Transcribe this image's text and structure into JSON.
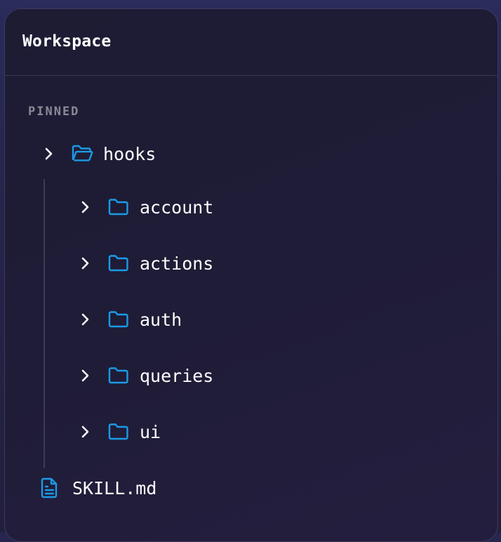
{
  "panel": {
    "title": "Workspace"
  },
  "section": {
    "label": "PINNED"
  },
  "tree": {
    "root": {
      "label": "hooks",
      "icon": "folder-open-icon"
    },
    "children": [
      {
        "label": "account",
        "icon": "folder-icon"
      },
      {
        "label": "actions",
        "icon": "folder-icon"
      },
      {
        "label": "auth",
        "icon": "folder-icon"
      },
      {
        "label": "queries",
        "icon": "folder-icon"
      },
      {
        "label": "ui",
        "icon": "folder-icon"
      }
    ],
    "file": {
      "label": "SKILL.md",
      "icon": "file-text-icon"
    }
  },
  "colors": {
    "accent": "#1b9be6",
    "text": "#ffffff",
    "muted": "#8a8a96"
  }
}
